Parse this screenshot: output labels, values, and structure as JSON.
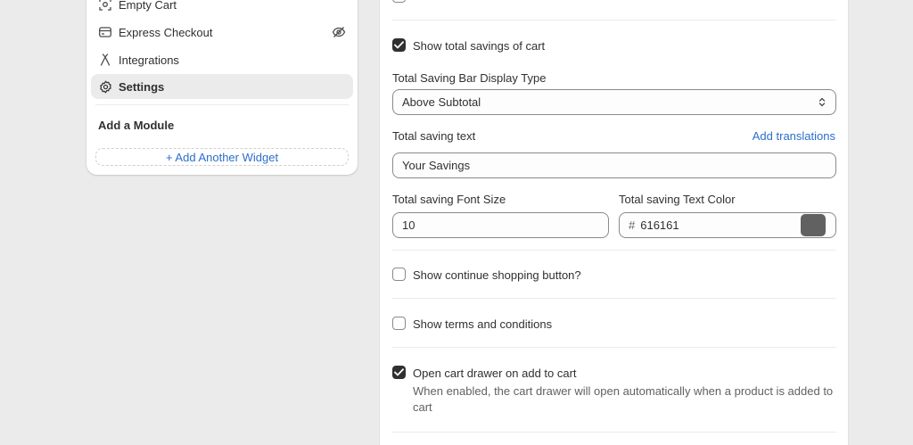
{
  "sidebar": {
    "items": [
      {
        "label": "Empty Cart",
        "icon": "empty-cart-icon"
      },
      {
        "label": "Express Checkout",
        "icon": "card-icon",
        "trailing_icon": "eye-hidden-icon"
      },
      {
        "label": "Integrations",
        "icon": "integrations-icon"
      },
      {
        "label": "Settings",
        "icon": "gear-icon",
        "active": true
      }
    ],
    "section_title": "Add a Module",
    "add_widget_label": "+ Add Another Widget"
  },
  "settings": {
    "show_savings": {
      "label": "Show total savings of cart",
      "checked": true
    },
    "bar_display_type": {
      "label": "Total Saving Bar Display Type",
      "value": "Above Subtotal"
    },
    "saving_text": {
      "label": "Total saving text",
      "translations_link": "Add translations",
      "value": "Your Savings"
    },
    "font_size": {
      "label": "Total saving Font Size",
      "value": "10"
    },
    "text_color": {
      "label": "Total saving Text Color",
      "prefix": "#",
      "value": "616161",
      "swatch": "#616161"
    },
    "continue_shopping": {
      "label": "Show continue shopping button?",
      "checked": false
    },
    "terms": {
      "label": "Show terms and conditions",
      "checked": false
    },
    "open_drawer": {
      "label": "Open cart drawer on add to cart",
      "checked": true,
      "help_line1": "When enabled, the cart drawer will open automatically when a product is added to",
      "help_line2": "cart"
    }
  },
  "colors": {
    "accent_link": "#2c6ecb",
    "checkbox_checked": "#303030",
    "page_bg": "#ebebeb"
  }
}
